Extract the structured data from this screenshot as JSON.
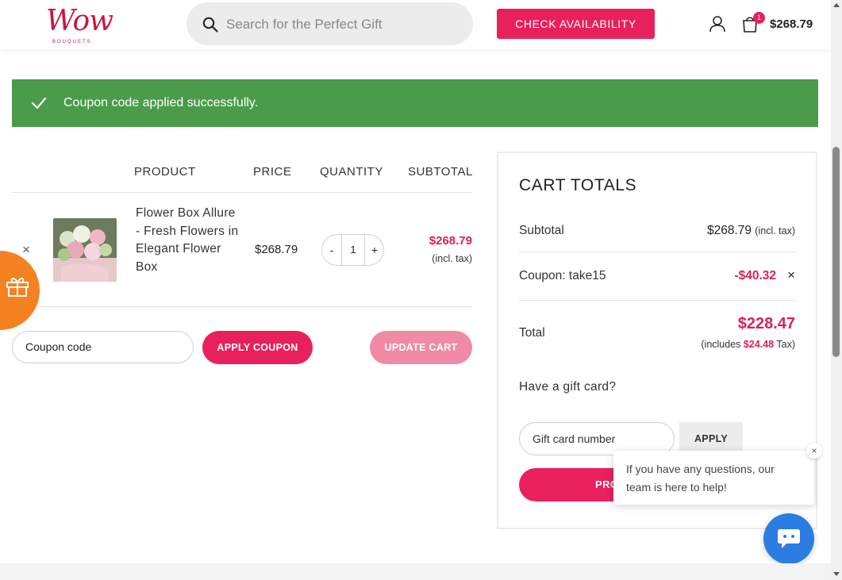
{
  "header": {
    "logo_text": "Wow",
    "logo_sub": "BOUQUETS",
    "search_placeholder": "Search for the Perfect Gift",
    "check_availability": "CHECK AVAILABILITY",
    "cart_count": "1",
    "cart_total": "$268.79"
  },
  "notice": {
    "message": "Coupon code applied successfully."
  },
  "cart_table": {
    "headers": [
      "PRODUCT",
      "PRICE",
      "QUANTITY",
      "SUBTOTAL"
    ],
    "item": {
      "name": "Flower Box Allure - Fresh Flowers in Elegant Flower Box",
      "price": "$268.79",
      "quantity": "1",
      "qty_minus": "-",
      "qty_plus": "+",
      "subtotal": "$268.79",
      "subtotal_note": "(incl. tax)",
      "remove": "×"
    },
    "coupon_placeholder": "Coupon code",
    "apply_coupon": "APPLY COUPON",
    "update_cart": "UPDATE CART"
  },
  "gift_widget": {
    "close": "×"
  },
  "totals": {
    "title": "CART TOTALS",
    "subtotal_label": "Subtotal",
    "subtotal_value": "$268.79",
    "subtotal_note": "(incl. tax)",
    "coupon_label": "Coupon: take15",
    "coupon_value": "-$40.32",
    "coupon_remove": "×",
    "total_label": "Total",
    "total_value": "$228.47",
    "tax_prefix": "(includes ",
    "tax_value": "$24.48",
    "tax_suffix": " Tax)",
    "gift_question": "Have a gift card?",
    "gift_placeholder": "Gift card number",
    "gift_apply": "APPLY",
    "proceed_partial": "PRO"
  },
  "chat": {
    "message": "If you have any questions, our team is here to help!",
    "close": "×"
  },
  "colors": {
    "accent": "#e8205c",
    "success": "#4a9b4a",
    "price_pink": "#d62356",
    "gift_orange": "#f58220",
    "chat_blue": "#2b7de1"
  }
}
